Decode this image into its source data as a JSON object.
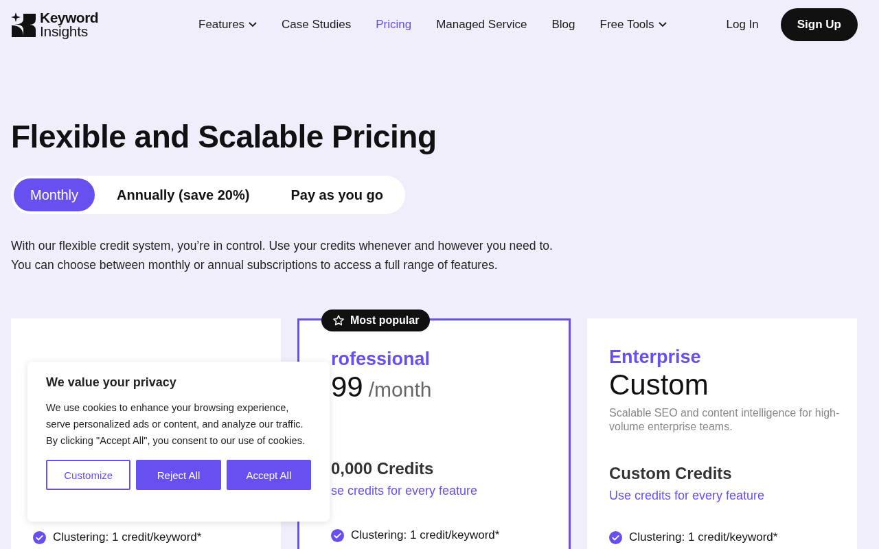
{
  "header": {
    "logo": {
      "line1": "Keyword",
      "line2": "Insights"
    },
    "nav": [
      {
        "label": "Features",
        "selected": false,
        "has_menu": true
      },
      {
        "label": "Case Studies",
        "selected": false,
        "has_menu": false
      },
      {
        "label": "Pricing",
        "selected": true,
        "has_menu": false
      },
      {
        "label": "Managed Service",
        "selected": false,
        "has_menu": false
      },
      {
        "label": "Blog",
        "selected": false,
        "has_menu": false
      },
      {
        "label": "Free Tools",
        "selected": false,
        "has_menu": true
      }
    ],
    "login": "Log In",
    "signup": "Sign Up"
  },
  "title": "Flexible and Scalable Pricing",
  "billing": [
    {
      "label": "Monthly",
      "selected": true
    },
    {
      "label": "Annually (save 20%)",
      "selected": false
    },
    {
      "label": "Pay as you go",
      "selected": false
    }
  ],
  "intro": [
    "With our flexible credit system, you’re in control. Use your credits whenever and however you need to.",
    "You can choose between monthly or annual subscriptions to access a full range of features."
  ],
  "plans": [
    {
      "featured": false,
      "features": [
        "Clustering: 1 credit/keyword*"
      ]
    },
    {
      "featured": true,
      "badge": "Most popular",
      "name": "rofessional",
      "price": "99",
      "period": "/month",
      "credits": "0,000 Credits",
      "credits_note": "se credits for every feature",
      "features": [
        "Clustering: 1 credit/keyword*"
      ]
    },
    {
      "featured": false,
      "name": "Enterprise",
      "price": "Custom",
      "description": "Scalable SEO and content intelligence for high-volume enterprise teams.",
      "credits": "Custom Credits",
      "credits_note": "Use credits for every feature",
      "features": [
        "Clustering: 1 credit/keyword*"
      ]
    }
  ],
  "cookie_dialog": {
    "title": "We value your privacy",
    "body": "We use cookies to enhance your browsing experience, serve personalized ads or content, and analyze our traffic. By clicking \"Accept All\", you consent to our use of cookies.",
    "buttons": [
      {
        "label": "Customize",
        "kind": "outline"
      },
      {
        "label": "Reject All",
        "kind": "filled"
      },
      {
        "label": "Accept All",
        "kind": "filled"
      }
    ]
  }
}
